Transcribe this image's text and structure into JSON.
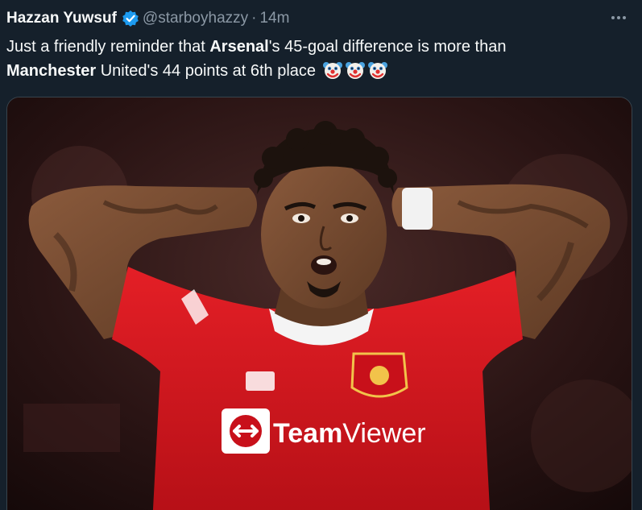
{
  "tweet": {
    "author_name": "Hazzan Yuwsuf",
    "author_handle": "@starboyhazzy",
    "separator": "·",
    "time": "14m",
    "text_parts": {
      "p1": "Just a friendly reminder that ",
      "b1": "Arsenal",
      "p2": "'s 45-goal difference is more than",
      "b2": "Manchester",
      "p3": " United's 44 points at 6th place"
    },
    "emojis": [
      "clown-face",
      "clown-face",
      "clown-face"
    ]
  },
  "media": {
    "kit_sponsor": "TeamViewer",
    "kit_sponsor_team": "Team",
    "kit_sponsor_viewer": "Viewer"
  },
  "colors": {
    "background": "#15202b",
    "text": "#f7f9f9",
    "muted": "#8b98a5",
    "verified": "#1d9bf0",
    "shirt_red": "#d4161f"
  }
}
